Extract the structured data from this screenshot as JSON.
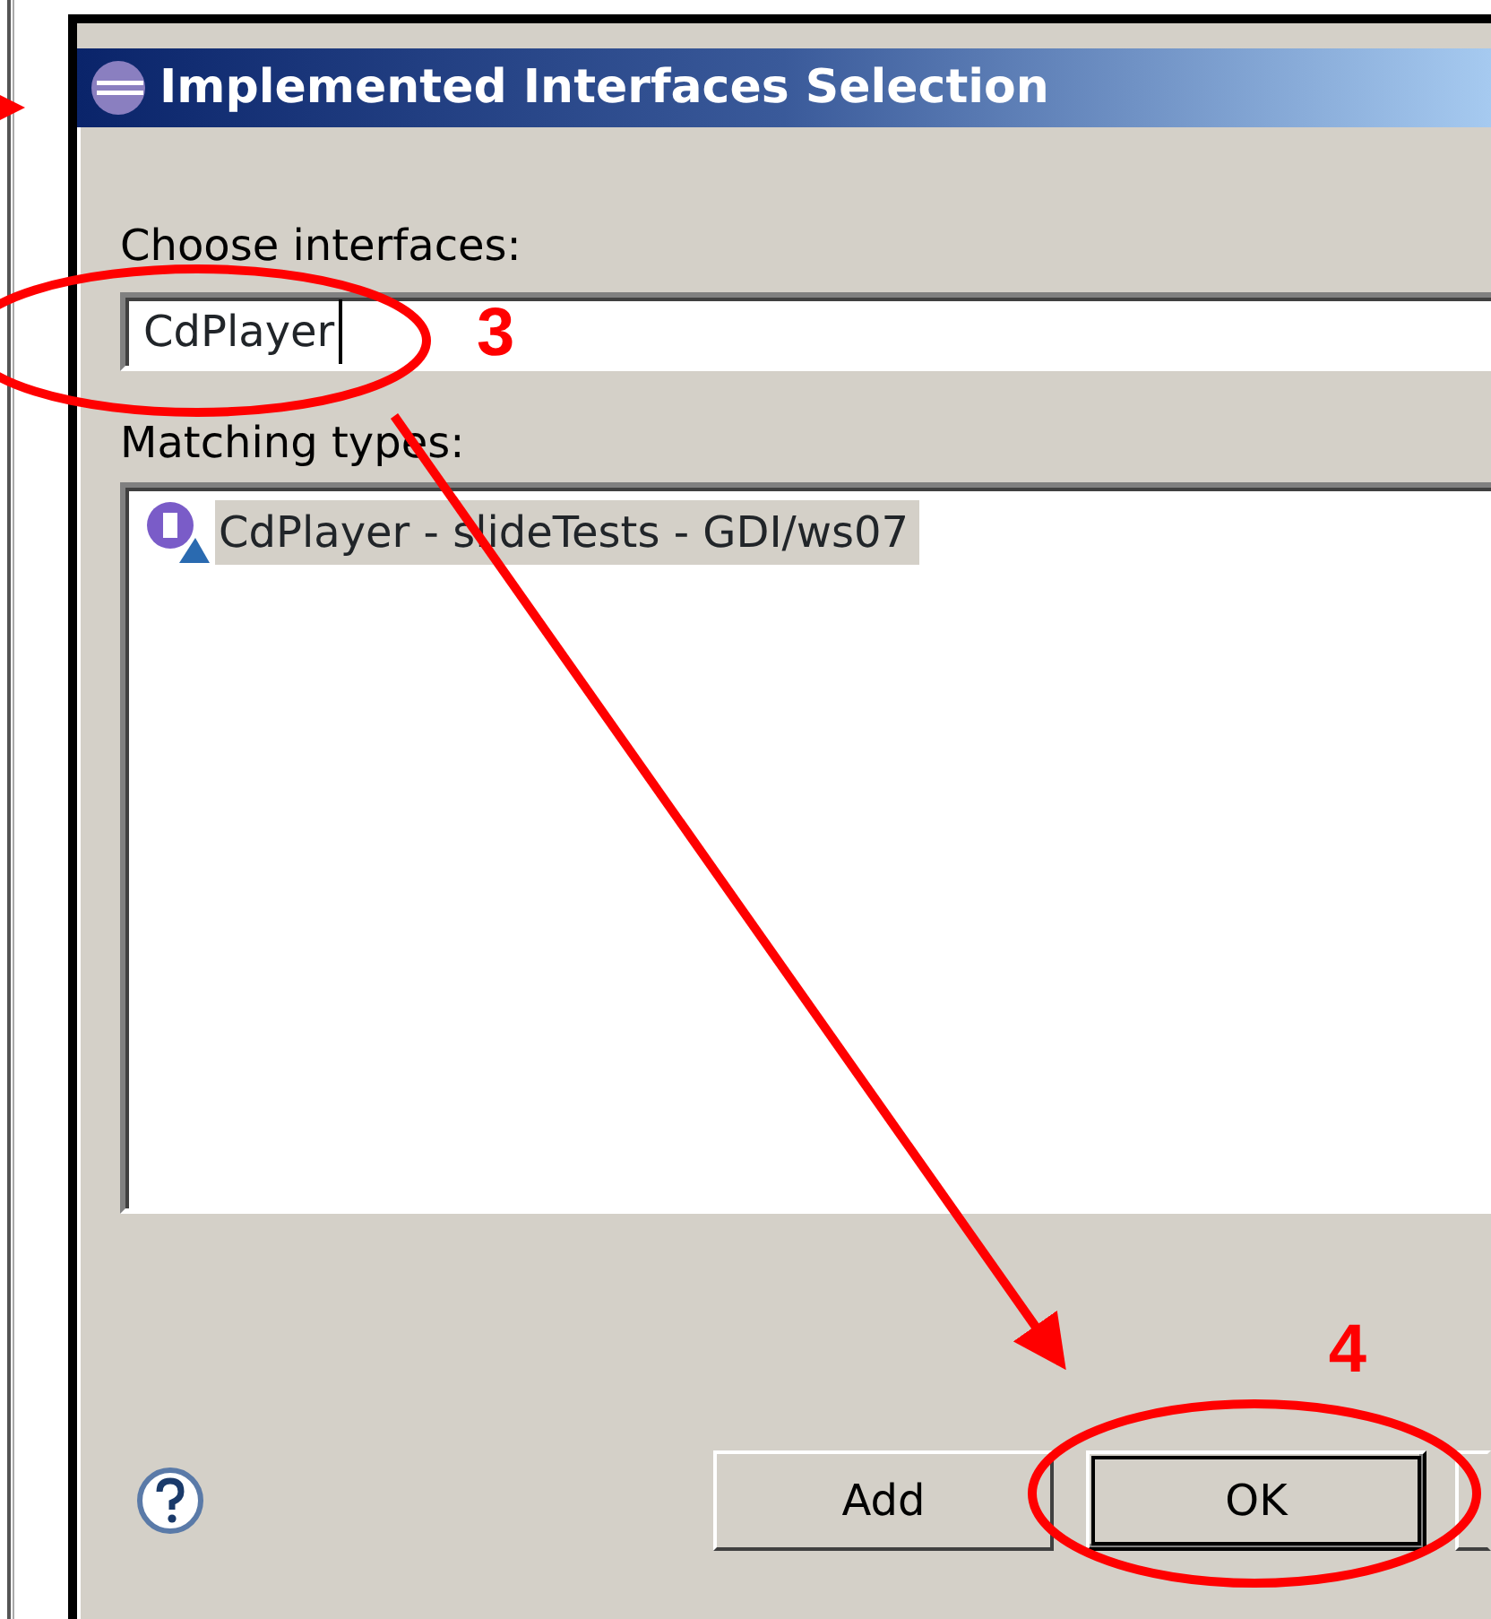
{
  "window": {
    "title": "Implemented Interfaces Selection"
  },
  "filter": {
    "label": "Choose interfaces:",
    "value": "CdPlayer"
  },
  "matches": {
    "label": "Matching types:",
    "items": [
      {
        "text": "CdPlayer - slideTests - GDI/ws07",
        "selected": true
      }
    ]
  },
  "buttons": [
    {
      "label": "Add",
      "default": false
    },
    {
      "label": "OK",
      "default": true
    }
  ],
  "annotations": [
    {
      "kind": "pointer"
    },
    {
      "kind": "callout",
      "label": "3"
    },
    {
      "kind": "arrow"
    },
    {
      "kind": "callout",
      "label": "4"
    }
  ]
}
